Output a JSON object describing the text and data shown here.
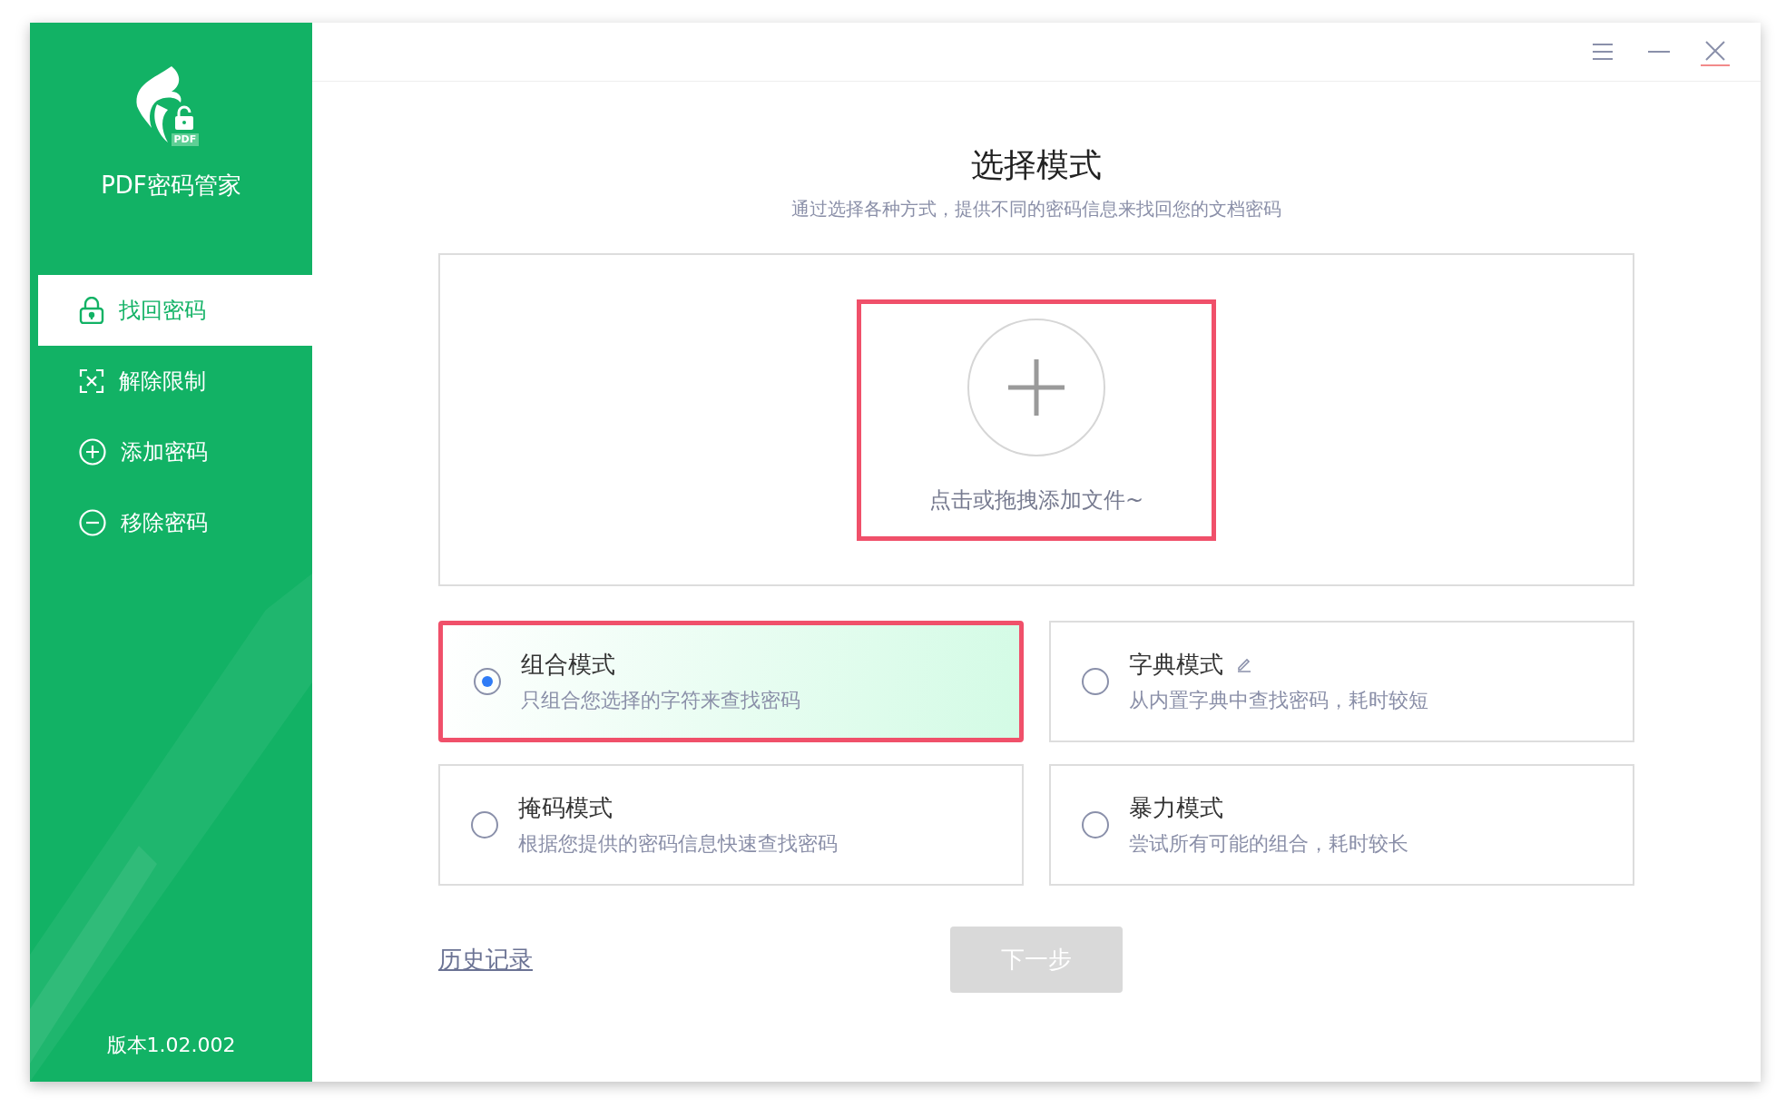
{
  "sidebar": {
    "app_name": "PDF密码管家",
    "logo_badge": "PDF",
    "items": [
      {
        "label": "找回密码",
        "selected": true
      },
      {
        "label": "解除限制",
        "selected": false
      },
      {
        "label": "添加密码",
        "selected": false
      },
      {
        "label": "移除密码",
        "selected": false
      }
    ],
    "version": "版本1.02.002"
  },
  "header": {
    "title": "选择模式",
    "subtitle": "通过选择各种方式，提供不同的密码信息来找回您的文档密码"
  },
  "upload": {
    "label": "点击或拖拽添加文件~",
    "highlighted": true
  },
  "modes": [
    {
      "title": "组合模式",
      "description": "只组合您选择的字符来查找密码",
      "selected": true,
      "highlighted": true,
      "editable": false
    },
    {
      "title": "字典模式",
      "description": "从内置字典中查找密码，耗时较短",
      "selected": false,
      "highlighted": false,
      "editable": true
    },
    {
      "title": "掩码模式",
      "description": "根据您提供的密码信息快速查找密码",
      "selected": false,
      "highlighted": false,
      "editable": false
    },
    {
      "title": "暴力模式",
      "description": "尝试所有可能的组合，耗时较长",
      "selected": false,
      "highlighted": false,
      "editable": false
    }
  ],
  "history_link": "历史记录",
  "next_button": {
    "label": "下一步",
    "disabled": true
  }
}
